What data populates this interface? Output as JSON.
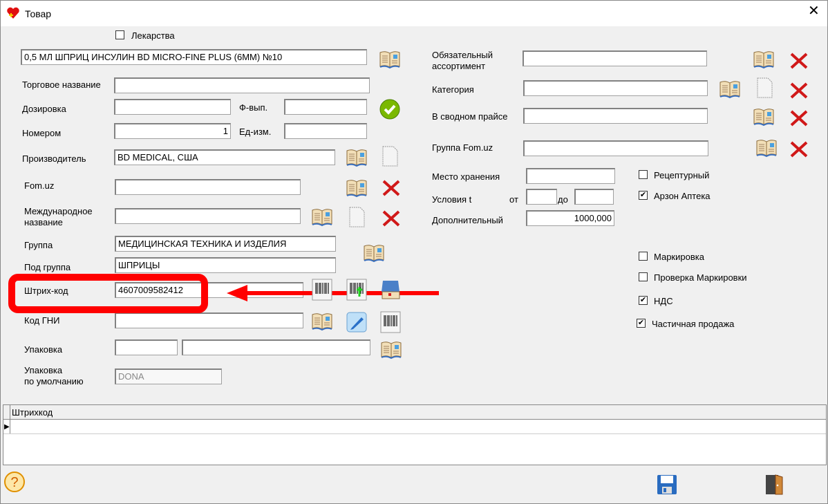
{
  "window": {
    "title": "Товар"
  },
  "left": {
    "medicines_label": "Лекарства",
    "medicines_checked": false,
    "name_value": "0,5 МЛ ШПРИЦ ИНСУЛИН BD MICRO-FINE PLUS (6MM) №10",
    "trade_name_label": "Торговое название",
    "trade_name_value": "",
    "dosage_label": "Дозировка",
    "dosage_value": "",
    "form_label": "Ф-вып.",
    "form_value": "",
    "number_label": "Номером",
    "number_value": "1",
    "unit_label": "Ед-изм.",
    "unit_value": "",
    "manufacturer_label": "Производитель",
    "manufacturer_value": "BD MEDICAL, США",
    "fomuz_label": "Fom.uz",
    "fomuz_value": "",
    "intl_name_label_1": "Международное",
    "intl_name_label_2": "название",
    "intl_name_value": "",
    "group_label": "Группа",
    "group_value": "МЕДИЦИНСКАЯ ТЕХНИКА И ИЗДЕЛИЯ",
    "subgroup_label": "Под группа",
    "subgroup_value": "ШПРИЦЫ",
    "barcode_label": "Штрих-код",
    "barcode_value": "4607009582412",
    "gni_label": "Код ГНИ",
    "gni_value": "",
    "package_label": "Упаковка",
    "package_value_1": "",
    "package_value_2": "",
    "default_package_label_1": "Упаковка",
    "default_package_label_2": "по умолчанию",
    "default_package_value": "DONA"
  },
  "right": {
    "mandatory_label_1": "Обязательный",
    "mandatory_label_2": "ассортимент",
    "mandatory_value": "",
    "category_label": "Категория",
    "category_value": "",
    "summary_price_label": "В сводном прайсе",
    "summary_price_value": "",
    "fomuz_group_label": "Группа Fom.uz",
    "fomuz_group_value": "",
    "storage_label": "Место хранения",
    "storage_value": "",
    "temp_label": "Условия t",
    "from_label": "от",
    "from_value": "",
    "to_label": "до",
    "to_value": "",
    "extra_label": "Дополнительный",
    "extra_value": "1000,000",
    "checkboxes": [
      {
        "label": "Рецептурный",
        "checked": false
      },
      {
        "label": "Арзон Аптека",
        "checked": true
      },
      {
        "label": "Маркировка",
        "checked": false
      },
      {
        "label": "Проверка Маркировки",
        "checked": false
      },
      {
        "label": "НДС",
        "checked": true
      },
      {
        "label": "Частичная продажа",
        "checked": true
      }
    ]
  },
  "grid": {
    "column": "Штрихкод"
  },
  "colors": {
    "highlight": "#ff0000",
    "bg": "#f0f0f0"
  }
}
